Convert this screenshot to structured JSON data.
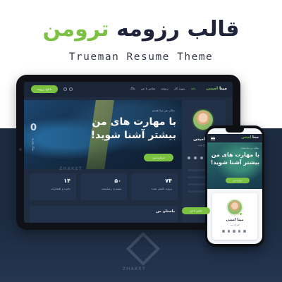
{
  "colors": {
    "accent": "#7cc242",
    "dark_navy": "#1d2b40",
    "headline_dark": "#20243a"
  },
  "headline": {
    "part_dark": "قالب رزومه",
    "part_green": "ترومن"
  },
  "subtitle": "Trueman Resume Theme",
  "tablet": {
    "brand": {
      "name": "مینا",
      "highlight": "امینی"
    },
    "nav": [
      "خانه",
      "نمونه کار",
      "رزومه",
      "تماس با من",
      "بلاگ"
    ],
    "top_button": "دانلود رزومه",
    "icons": [
      "search-icon",
      "moon-icon"
    ],
    "profile": {
      "name": "مینا امینی",
      "role": "طراح وب"
    },
    "hero": {
      "small_text": "سلام، من مینا هستم",
      "title_line1": "با مهارت های من",
      "title_line2": "بیشتر آشنا شوید!",
      "button": "درباره من",
      "vertical_number": "0",
      "vertical_text": "سال تجربه"
    },
    "stats": [
      {
        "num": "۱۴",
        "label": "جایزه و افتخارات"
      },
      {
        "num": "۵۰",
        "label": "مشتری رضایتمند"
      },
      {
        "num": "۷۴",
        "label": "پروژه تکمیل شده"
      }
    ],
    "story_heading": "داستان من"
  },
  "watermark": {
    "text": "ZHAKET"
  },
  "phone": {
    "brand": {
      "name": "مینا",
      "highlight": "امینی"
    },
    "hero": {
      "small_text": "سلام، من مینا هستم",
      "title_line1": "با مهارت های من",
      "title_line2": "بیشتر آشنا شوید!",
      "button": "درباره من"
    },
    "contact_button": "تماس با من",
    "profile": {
      "name": "مینا امینی",
      "role": "طراح وب"
    }
  }
}
